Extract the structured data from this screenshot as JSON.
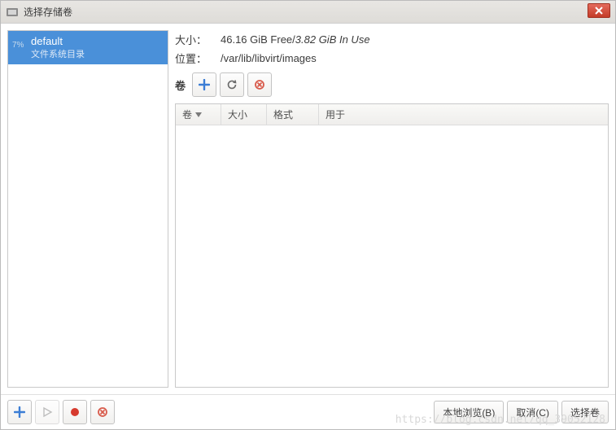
{
  "window": {
    "title": "选择存储卷"
  },
  "pools": [
    {
      "name": "default",
      "type": "文件系统目录",
      "usage_pct": "7%"
    }
  ],
  "info": {
    "size_label": "大小：",
    "free": "46.16 GiB Free",
    "sep": " / ",
    "in_use": "3.82 GiB In Use",
    "loc_label": "位置：",
    "location": "/var/lib/libvirt/images"
  },
  "vol_toolbar": {
    "label": "卷"
  },
  "columns": {
    "vol": "卷",
    "size": "大小",
    "format": "格式",
    "used_for": "用于"
  },
  "buttons": {
    "browse_local": "本地浏览(B)",
    "cancel": "取消(C)",
    "choose": "选择卷"
  },
  "watermark": "https://blog.csdn.net/qq_39052128"
}
